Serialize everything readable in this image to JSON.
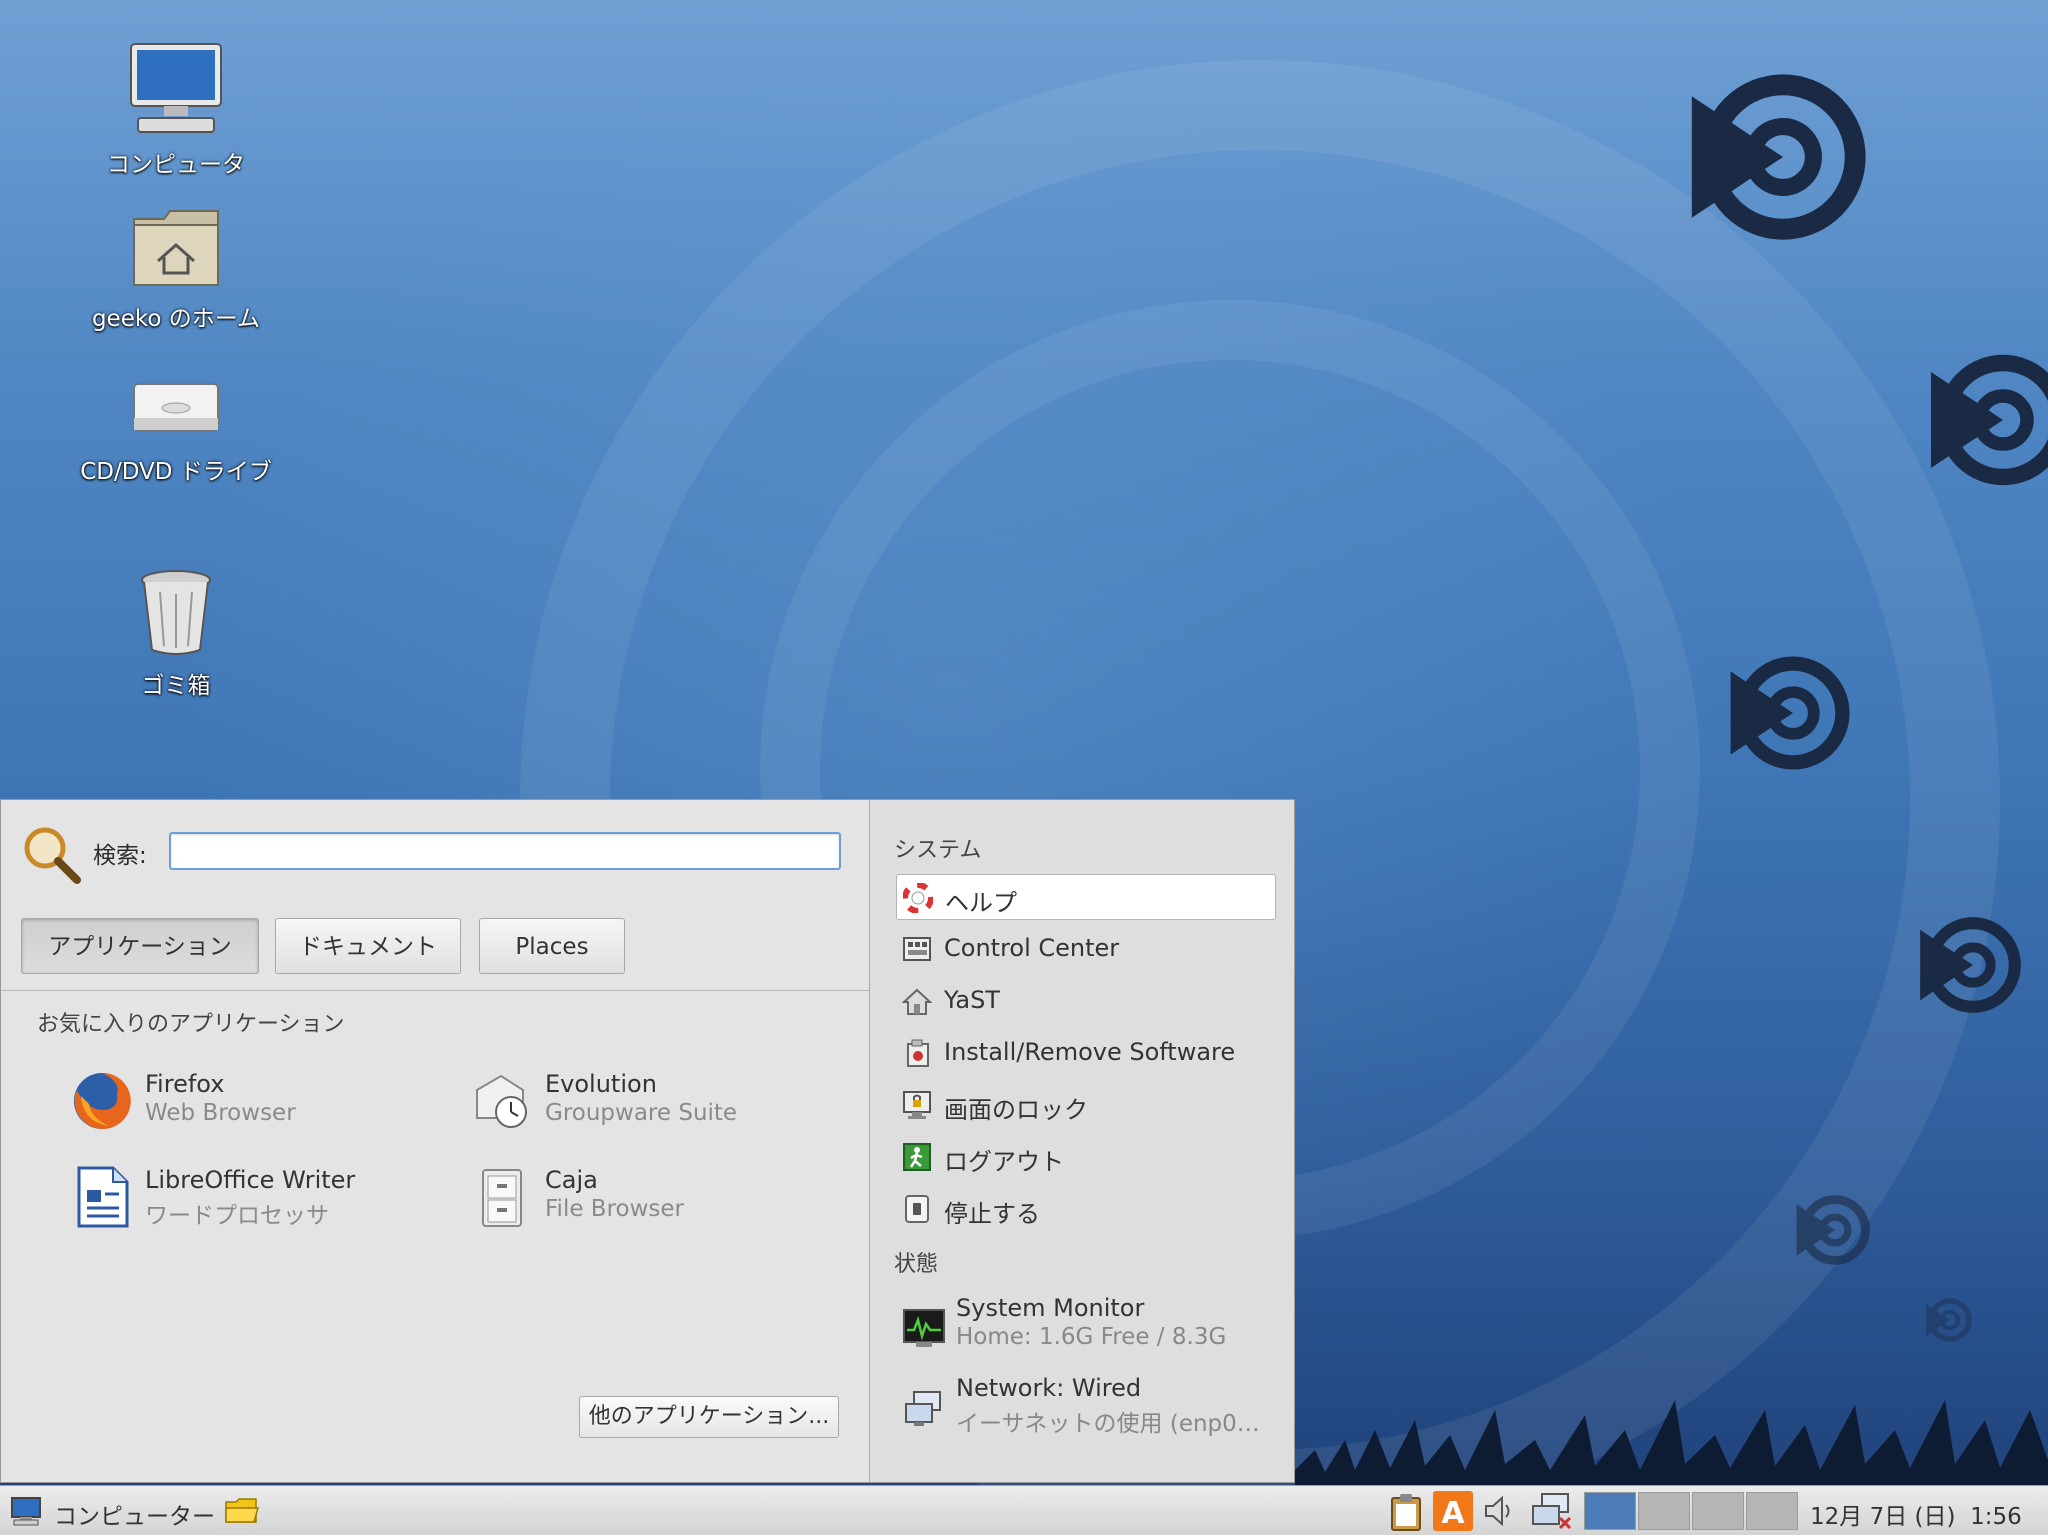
{
  "desktop": {
    "icons": [
      {
        "label": "コンピュータ",
        "icon": "computer-icon"
      },
      {
        "label": "geeko のホーム",
        "icon": "home-folder-icon"
      },
      {
        "label": "CD/DVD ドライブ",
        "icon": "optical-drive-icon"
      },
      {
        "label": "ゴミ箱",
        "icon": "trash-icon"
      }
    ]
  },
  "menu": {
    "search": {
      "label": "検索:",
      "value": "",
      "placeholder": ""
    },
    "tabs": [
      {
        "label": "アプリケーション",
        "active": true
      },
      {
        "label": "ドキュメント",
        "active": false
      },
      {
        "label": "Places",
        "active": false
      }
    ],
    "favorites_title": "お気に入りのアプリケーション",
    "favorites": [
      {
        "name": "Firefox",
        "desc": "Web Browser",
        "icon": "firefox-icon"
      },
      {
        "name": "Evolution",
        "desc": "Groupware Suite",
        "icon": "evolution-icon"
      },
      {
        "name": "LibreOffice Writer",
        "desc": "ワードプロセッサ",
        "icon": "writer-document-icon"
      },
      {
        "name": "Caja",
        "desc": "File Browser",
        "icon": "file-cabinet-icon"
      }
    ],
    "more_apps": "他のアプリケーション...",
    "system_title": "システム",
    "system": [
      {
        "label": "ヘルプ",
        "icon": "help-lifebuoy-icon"
      },
      {
        "label": "Control Center",
        "icon": "control-center-icon"
      },
      {
        "label": "YaST",
        "icon": "yast-icon"
      },
      {
        "label": "Install/Remove Software",
        "icon": "software-install-icon"
      },
      {
        "label": "画面のロック",
        "icon": "lock-screen-icon"
      },
      {
        "label": "ログアウト",
        "icon": "logout-icon"
      },
      {
        "label": "停止する",
        "icon": "shutdown-icon"
      }
    ],
    "status_title": "状態",
    "status": [
      {
        "title": "System Monitor",
        "detail": "Home: 1.6G Free / 8.3G",
        "icon": "system-monitor-icon"
      },
      {
        "title": "Network: Wired",
        "detail": "イーサネットの使用 (enp0…",
        "icon": "network-wired-icon"
      }
    ]
  },
  "taskbar": {
    "menu_button": "コンピューター",
    "clock": "12月 7日 (日)  1:56",
    "workspaces": [
      true,
      false,
      false,
      false
    ]
  },
  "colors": {
    "accent": "#4d7db8",
    "wallpaper": "#3f76b6"
  }
}
